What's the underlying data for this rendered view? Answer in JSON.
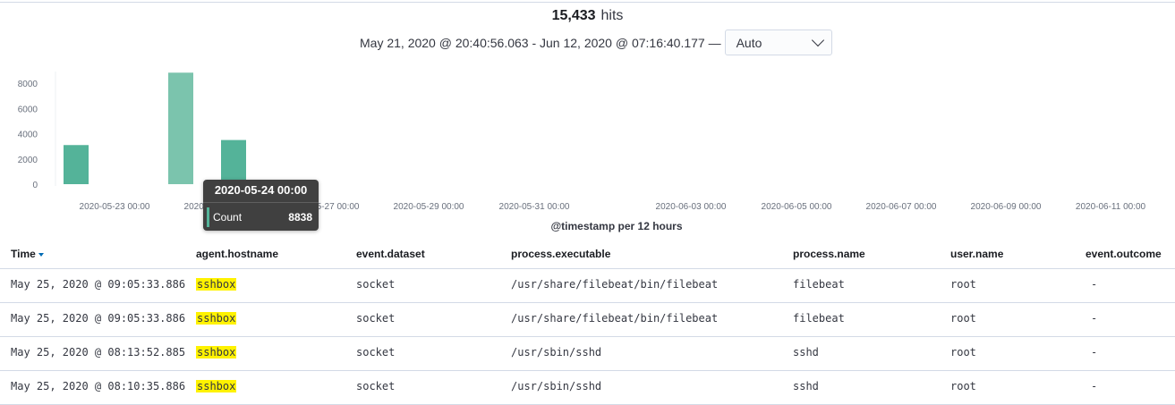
{
  "summary": {
    "hits_count": "15,433",
    "hits_label": "hits",
    "time_range": "May 21, 2020 @ 20:40:56.063 - Jun 12, 2020 @ 07:16:40.177 —",
    "interval_value": "Auto"
  },
  "chart_data": {
    "type": "bar",
    "xlabel": "@timestamp per 12 hours",
    "ylim": [
      0,
      9000
    ],
    "yticks": [
      0,
      2000,
      4000,
      6000,
      8000
    ],
    "x_tick_labels": [
      "2020-05-23 00:00",
      "2020-05-25 00:00",
      "2020-05-27 00:00",
      "2020-05-29 00:00",
      "2020-05-31 00:00",
      "2020-06-03 00:00",
      "2020-06-05 00:00",
      "2020-06-07 00:00",
      "2020-06-09 00:00",
      "2020-06-11 00:00"
    ],
    "categories": [
      "2020-05-23 00:00",
      "2020-05-24 00:00",
      "2020-05-24 12:00"
    ],
    "values": [
      3100,
      8838,
      3500
    ],
    "highlight_index": 1,
    "bar_color": "#54b399",
    "bar_highlight_color": "#7bc4ad",
    "grid": false
  },
  "tooltip": {
    "title": "2020-05-24 00:00",
    "label": "Count",
    "value": "8838"
  },
  "table": {
    "columns": [
      "Time",
      "agent.hostname",
      "event.dataset",
      "process.executable",
      "process.name",
      "user.name",
      "event.outcome"
    ],
    "rows": [
      {
        "time": "May 25, 2020 @ 09:05:33.886",
        "hostname": "sshbox",
        "dataset": "socket",
        "executable": "/usr/share/filebeat/bin/filebeat",
        "name": "filebeat",
        "user": "root",
        "outcome": "-"
      },
      {
        "time": "May 25, 2020 @ 09:05:33.886",
        "hostname": "sshbox",
        "dataset": "socket",
        "executable": "/usr/share/filebeat/bin/filebeat",
        "name": "filebeat",
        "user": "root",
        "outcome": "-"
      },
      {
        "time": "May 25, 2020 @ 08:13:52.885",
        "hostname": "sshbox",
        "dataset": "socket",
        "executable": "/usr/sbin/sshd",
        "name": "sshd",
        "user": "root",
        "outcome": "-"
      },
      {
        "time": "May 25, 2020 @ 08:10:35.886",
        "hostname": "sshbox",
        "dataset": "socket",
        "executable": "/usr/sbin/sshd",
        "name": "sshd",
        "user": "root",
        "outcome": "-"
      }
    ]
  }
}
